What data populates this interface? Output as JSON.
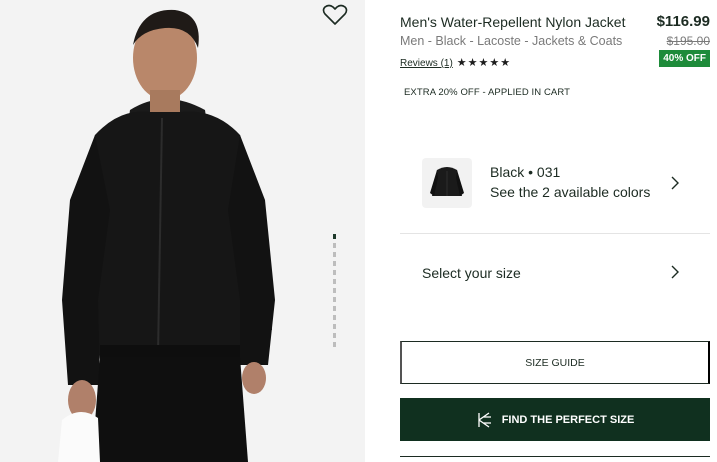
{
  "product": {
    "title": "Men's Water-Repellent Nylon Jacket",
    "subtitle": "Men - Black - Lacoste - Jackets & Coats",
    "reviews_label": "Reviews (1)",
    "rating": 5,
    "price": "$116.99",
    "old_price": "$195.00",
    "discount_badge": "40% OFF",
    "extra_promo": "EXTRA 20% OFF - APPLIED IN CART"
  },
  "gallery": {
    "total_images": 14,
    "active_index": 0
  },
  "color_selector": {
    "selected": "Black • 031",
    "count_text": "See the 2 available colors"
  },
  "size_selector": {
    "label": "Select your size"
  },
  "buttons": {
    "size_guide": "SIZE GUIDE",
    "find_size": "FIND THE PERFECT SIZE"
  },
  "icons": {
    "favorite": "heart-outline-icon",
    "chevron": "chevron-right-icon",
    "brand_fit": "k-fit-logo-icon",
    "star": "star-icon"
  },
  "colors": {
    "accent_dark": "#10301f",
    "badge_green": "#1e8b3a",
    "text": "#1c2b22",
    "muted": "#7a7a7a"
  }
}
